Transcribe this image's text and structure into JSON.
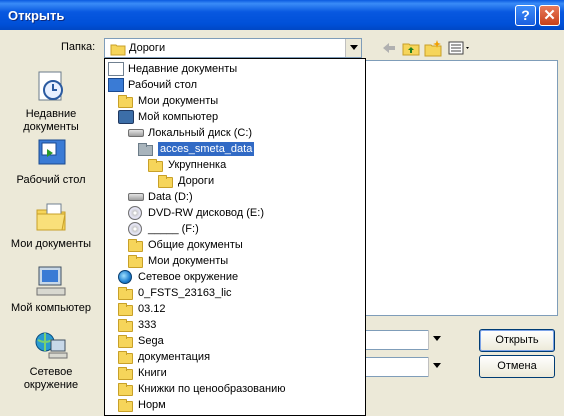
{
  "window": {
    "title": "Открыть",
    "help_glyph": "?",
    "close_glyph": "✕"
  },
  "lookin": {
    "label": "Папка:",
    "value": "Дороги"
  },
  "places": [
    {
      "label_line1": "Недавние",
      "label_line2": "документы",
      "icon": "recent-documents-icon"
    },
    {
      "label_line1": "Рабочий стол",
      "label_line2": "",
      "icon": "desktop-icon"
    },
    {
      "label_line1": "Мои документы",
      "label_line2": "",
      "icon": "my-documents-icon"
    },
    {
      "label_line1": "Мой компьютер",
      "label_line2": "",
      "icon": "my-computer-icon"
    },
    {
      "label_line1": "Сетевое",
      "label_line2": "окружение",
      "icon": "network-icon"
    }
  ],
  "dropdown_items": [
    {
      "label": "Недавние документы",
      "icon": "recent-icon",
      "indent": 0
    },
    {
      "label": "Рабочий стол",
      "icon": "desktop-icon",
      "indent": 0
    },
    {
      "label": "Мои документы",
      "icon": "folder-icon",
      "indent": 1
    },
    {
      "label": "Мой компьютер",
      "icon": "computer-icon",
      "indent": 1
    },
    {
      "label": "Локальный диск (C:)",
      "icon": "drive-icon",
      "indent": 2
    },
    {
      "label": "acces_smeta_data",
      "icon": "folder-gray-icon",
      "indent": 3,
      "selected": true
    },
    {
      "label": "Укрупненка",
      "icon": "folder-icon",
      "indent": 4
    },
    {
      "label": "Дороги",
      "icon": "folder-icon",
      "indent": 5
    },
    {
      "label": "Data (D:)",
      "icon": "drive-icon",
      "indent": 2
    },
    {
      "label": "DVD-RW дисковод (E:)",
      "icon": "cd-icon",
      "indent": 2
    },
    {
      "label": "_____ (F:)",
      "icon": "cd-icon",
      "indent": 2
    },
    {
      "label": "Общие документы",
      "icon": "folder-icon",
      "indent": 2
    },
    {
      "label": "Мои документы",
      "icon": "folder-icon",
      "indent": 2
    },
    {
      "label": "Сетевое окружение",
      "icon": "network-icon",
      "indent": 1
    },
    {
      "label": "0_FSTS_23163_lic",
      "icon": "folder-icon",
      "indent": 1
    },
    {
      "label": "03.12",
      "icon": "folder-icon",
      "indent": 1
    },
    {
      "label": "333",
      "icon": "folder-icon",
      "indent": 1
    },
    {
      "label": "Sega",
      "icon": "folder-icon",
      "indent": 1
    },
    {
      "label": "документация",
      "icon": "folder-icon",
      "indent": 1
    },
    {
      "label": "Книги",
      "icon": "folder-icon",
      "indent": 1
    },
    {
      "label": "Книжки по ценообразованию",
      "icon": "folder-icon",
      "indent": 1
    },
    {
      "label": "Норм",
      "icon": "folder-icon",
      "indent": 1
    }
  ],
  "buttons": {
    "open": "Открыть",
    "cancel": "Отмена"
  },
  "colors": {
    "title_blue": "#0050d8",
    "selection": "#316ac5",
    "folder": "#f6d55a"
  }
}
